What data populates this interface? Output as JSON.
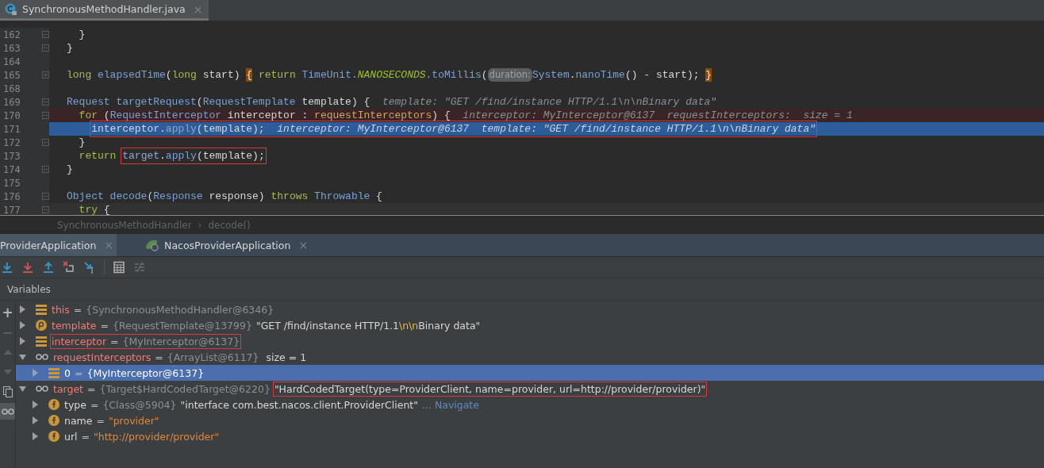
{
  "editor_tab": {
    "title": "SynchronousMethodHandler.java",
    "close": "×"
  },
  "code_lines": [
    {
      "number": "162",
      "folded": false,
      "tokens": [
        {
          "text": "  }",
          "kind": "plain"
        }
      ]
    },
    {
      "number": "163",
      "folded": false,
      "tokens": [
        {
          "text": "}",
          "kind": "plain"
        }
      ]
    },
    {
      "number": "164"
    },
    {
      "number": "165",
      "folded": true,
      "tokens": [
        {
          "text": "long",
          "kind": "keyword"
        },
        {
          "text": " elapsedTime",
          "kind": "method"
        },
        {
          "text": "(",
          "kind": "plain"
        },
        {
          "text": "long",
          "kind": "keyword"
        },
        {
          "text": " start) ",
          "kind": "plain"
        },
        {
          "text": "{",
          "kind": "brace"
        },
        {
          "text": " return",
          "kind": "keyword"
        },
        {
          "text": " TimeUnit.",
          "kind": "type"
        },
        {
          "text": "NANOSECONDS",
          "kind": "static"
        },
        {
          "text": ".toMillis",
          "kind": "method"
        },
        {
          "text": "(",
          "kind": "plain"
        },
        {
          "text": "duration:",
          "kind": "param"
        },
        {
          "text": "System",
          "kind": "type"
        },
        {
          "text": ".",
          "kind": "plain"
        },
        {
          "text": "nanoTime",
          "kind": "method"
        },
        {
          "text": "() - start); ",
          "kind": "plain"
        },
        {
          "text": "}",
          "kind": "brace"
        }
      ]
    },
    {
      "number": "168"
    },
    {
      "number": "169",
      "folded": false,
      "tokens": [
        {
          "text": "Request",
          "kind": "type"
        },
        {
          "text": " targetRequest",
          "kind": "method"
        },
        {
          "text": "(",
          "kind": "plain"
        },
        {
          "text": "RequestTemplate",
          "kind": "type"
        },
        {
          "text": " template) {  ",
          "kind": "plain"
        },
        {
          "text": "template: \"GET /find/instance HTTP/1.1\\n\\nBinary data\"",
          "kind": "hint"
        }
      ]
    },
    {
      "number": "170",
      "folded": false,
      "kind": "breakpoint",
      "tokens": [
        {
          "text": "  for",
          "kind": "keyword"
        },
        {
          "text": " (",
          "kind": "plain"
        },
        {
          "text": "RequestInterceptor",
          "kind": "type"
        },
        {
          "text": " interceptor : ",
          "kind": "plain"
        },
        {
          "text": "requestInterceptors",
          "kind": "field"
        },
        {
          "text": ") {  ",
          "kind": "plain"
        },
        {
          "text": "interceptor: MyInterceptor@6137  requestInterceptors:  size = 1",
          "kind": "hint"
        }
      ]
    },
    {
      "number": "171",
      "kind": "execution",
      "tokens": [
        {
          "text": "    interceptor.",
          "kind": "plain",
          "boxed": true
        },
        {
          "text": "apply",
          "kind": "dim",
          "boxed": true
        },
        {
          "text": "(template);  ",
          "kind": "plain",
          "boxed": true
        },
        {
          "text": "interceptor: MyInterceptor@6137  template: \"GET /find/instance HTTP/1.1\\n\\nBinary data\"",
          "kind": "hint",
          "boxed": true
        }
      ]
    },
    {
      "number": "172",
      "folded": false,
      "tokens": [
        {
          "text": "  }",
          "kind": "plain"
        }
      ]
    },
    {
      "number": "173",
      "tokens": [
        {
          "text": "  return",
          "kind": "keyword"
        },
        {
          "text": " target",
          "kind": "field2",
          "boxed": true
        },
        {
          "text": ".",
          "kind": "plain",
          "boxed": true
        },
        {
          "text": "apply",
          "kind": "method",
          "boxed": true
        },
        {
          "text": "(template);",
          "kind": "plain",
          "boxed": true
        }
      ]
    },
    {
      "number": "174",
      "folded": false,
      "tokens": [
        {
          "text": "}",
          "kind": "plain"
        }
      ]
    },
    {
      "number": "175"
    },
    {
      "number": "176",
      "folded": false,
      "tokens": [
        {
          "text": "Object",
          "kind": "type"
        },
        {
          "text": " decode",
          "kind": "method"
        },
        {
          "text": "(",
          "kind": "plain"
        },
        {
          "text": "Response",
          "kind": "type"
        },
        {
          "text": " response) ",
          "kind": "plain"
        },
        {
          "text": "throws",
          "kind": "keyword"
        },
        {
          "text": " Throwable",
          "kind": "type"
        },
        {
          "text": " {",
          "kind": "plain"
        }
      ]
    },
    {
      "number": "177",
      "folded": false,
      "kind": "current",
      "tokens": [
        {
          "text": "  try",
          "kind": "keyword"
        },
        {
          "text": " {",
          "kind": "plain"
        }
      ]
    }
  ],
  "breadcrumb": [
    "SynchronousMethodHandler",
    "›",
    "decode()"
  ],
  "debug_tabs": [
    {
      "label": "ProviderApplication",
      "close": "×",
      "selected": true,
      "icon": false
    },
    {
      "label": "NacosProviderApplication",
      "close": "×",
      "selected": false,
      "icon": true
    }
  ],
  "toolbar": [
    {
      "kind": "step-over"
    },
    {
      "kind": "step-into"
    },
    {
      "kind": "step-out"
    },
    {
      "kind": "drop-frame"
    },
    {
      "kind": "run-to-cursor"
    },
    {
      "kind": "separator"
    },
    {
      "kind": "evaluate"
    },
    {
      "kind": "trace",
      "disabled": true
    }
  ],
  "variables_title": "Variables",
  "side_buttons": [
    {
      "kind": "add",
      "label": "+",
      "disabled": false,
      "selected": false
    },
    {
      "kind": "remove",
      "label": "−",
      "disabled": true,
      "selected": false
    },
    {
      "kind": "up",
      "disabled": true,
      "selected": false
    },
    {
      "kind": "down",
      "disabled": true,
      "selected": false
    },
    {
      "kind": "copy",
      "disabled": false,
      "selected": false
    },
    {
      "kind": "watches",
      "disabled": false,
      "selected": true
    }
  ],
  "variables": [
    {
      "kind": "field",
      "name": "this",
      "local": true,
      "expanded": false,
      "selected": false,
      "value": [
        {
          "text": "=",
          "kind": "plain"
        },
        {
          "text": "{SynchronousMethodHandler@6346}",
          "kind": "ref"
        }
      ]
    },
    {
      "kind": "param",
      "name": "template",
      "local": true,
      "expanded": false,
      "selected": false,
      "value": [
        {
          "text": "=",
          "kind": "plain"
        },
        {
          "text": "{RequestTemplate@13799}",
          "kind": "ref"
        },
        {
          "text": "\"GET /find/instance HTTP/1.1",
          "kind": "string"
        },
        {
          "text": "\\n\\n",
          "kind": "escape"
        },
        {
          "text": "Binary data\"",
          "kind": "string"
        }
      ]
    },
    {
      "kind": "field",
      "name": "interceptor",
      "local": true,
      "expanded": false,
      "selected": false,
      "boxed": true,
      "value": [
        {
          "text": "=",
          "kind": "plain"
        },
        {
          "text": "{MyInterceptor@6137}",
          "kind": "ref"
        }
      ]
    },
    {
      "kind": "watch",
      "name": "requestInterceptors",
      "local": true,
      "expanded": true,
      "selected": false,
      "value": [
        {
          "text": "=",
          "kind": "plain"
        },
        {
          "text": "{ArrayList@6117}",
          "kind": "ref"
        },
        {
          "text": " size = 1",
          "kind": "string"
        }
      ],
      "children": [
        {
          "kind": "field",
          "name": "0",
          "local": false,
          "expanded": false,
          "selected": true,
          "value": [
            {
              "text": "=",
              "kind": "plain"
            },
            {
              "text": "{MyInterceptor@6137}",
              "kind": "ref"
            }
          ]
        }
      ]
    },
    {
      "kind": "watch",
      "name": "target",
      "local": true,
      "expanded": true,
      "selected": false,
      "value": [
        {
          "text": "=",
          "kind": "plain"
        },
        {
          "text": "{Target$HardCodedTarget@6220}",
          "kind": "ref"
        },
        {
          "text": "\"HardCodedTarget(type=ProviderClient, name=provider, url=http://provider/provider)\"",
          "kind": "string",
          "boxed": true
        }
      ],
      "children": [
        {
          "kind": "final",
          "name": "type",
          "local": false,
          "expanded": false,
          "selected": false,
          "value": [
            {
              "text": "=",
              "kind": "plain"
            },
            {
              "text": "{Class@5904}",
              "kind": "ref"
            },
            {
              "text": "\"interface com.best.nacos.client.ProviderClient\"",
              "kind": "string"
            },
            {
              "text": "... Navigate",
              "kind": "link"
            }
          ]
        },
        {
          "kind": "final",
          "name": "name",
          "local": false,
          "expanded": false,
          "selected": false,
          "value": [
            {
              "text": "=",
              "kind": "plain"
            },
            {
              "text": "\"provider\"",
              "kind": "literal"
            }
          ]
        },
        {
          "kind": "final",
          "name": "url",
          "local": false,
          "expanded": false,
          "selected": false,
          "value": [
            {
              "text": "=",
              "kind": "plain"
            },
            {
              "text": "\"http://provider/provider\"",
              "kind": "literal"
            }
          ]
        }
      ]
    }
  ]
}
